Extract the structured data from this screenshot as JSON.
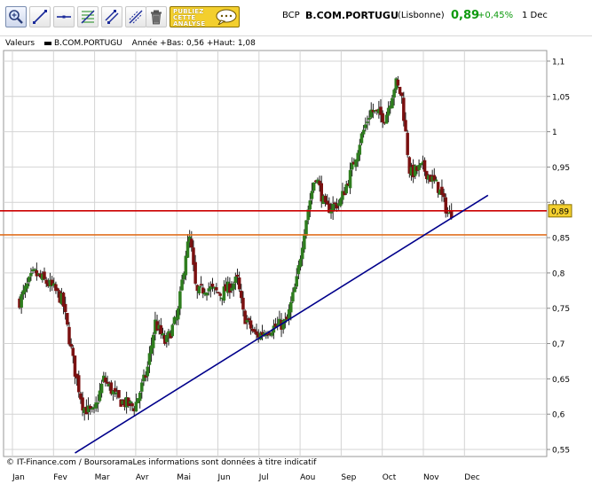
{
  "toolbar": {
    "tools": [
      {
        "name": "zoom-tool",
        "icon": "magnifier-icon"
      },
      {
        "name": "trend-line-tool",
        "icon": "diagonal-line-icon"
      },
      {
        "name": "horizontal-line-tool",
        "icon": "horizontal-line-icon"
      },
      {
        "name": "fibonacci-tool",
        "icon": "fibonacci-icon"
      },
      {
        "name": "channel-tool",
        "icon": "channel-icon"
      },
      {
        "name": "parallel-lines-tool",
        "icon": "parallel-lines-icon"
      },
      {
        "name": "delete-tool",
        "icon": "trash-icon"
      }
    ],
    "publish_button": {
      "lines": [
        "PUBLIEZ",
        "CETTE",
        "ANALYSE"
      ],
      "icon": "speech-bubble-icon"
    }
  },
  "header": {
    "ticker": "BCP",
    "name": "B.COM.PORTUGU",
    "market": "(Lisbonne)",
    "price": "0,89",
    "change": "+0,45%",
    "date": "1 Dec",
    "price_color": "#0e9a0e"
  },
  "legend": {
    "label": "Valeurs",
    "series": "B.COM.PORTUGU",
    "range": "Année +Bas: 0,56 +Haut: 1,08"
  },
  "footer": {
    "credit": "© IT-Finance.com / BoursoramaLes informations sont données à titre indicatif"
  },
  "chart_data": {
    "type": "candlestick",
    "x_labels": [
      "Jan",
      "Fev",
      "Mar",
      "Avr",
      "Mai",
      "Jun",
      "Jul",
      "Aou",
      "Sep",
      "Oct",
      "Nov",
      "Dec"
    ],
    "y_ticks": [
      "0,55",
      "0,6",
      "0,65",
      "0,7",
      "0,75",
      "0,8",
      "0,85",
      "0,9",
      "0,95",
      "1",
      "1,05",
      "1,1"
    ],
    "y_tick_values": [
      0.55,
      0.6,
      0.65,
      0.7,
      0.75,
      0.8,
      0.85,
      0.9,
      0.95,
      1.0,
      1.05,
      1.1
    ],
    "ylim": [
      0.54,
      1.115
    ],
    "grid": true,
    "up_color": "#2e7d1e",
    "down_color": "#7a1010",
    "anchors": [
      [
        0,
        0.76
      ],
      [
        0.35,
        0.8
      ],
      [
        0.8,
        0.78
      ],
      [
        1.05,
        0.76
      ],
      [
        1.35,
        0.66
      ],
      [
        1.55,
        0.61
      ],
      [
        1.8,
        0.6
      ],
      [
        2.05,
        0.65
      ],
      [
        2.4,
        0.62
      ],
      [
        2.8,
        0.61
      ],
      [
        3.1,
        0.66
      ],
      [
        3.3,
        0.73
      ],
      [
        3.55,
        0.7
      ],
      [
        3.85,
        0.74
      ],
      [
        4.05,
        0.83
      ],
      [
        4.15,
        0.85
      ],
      [
        4.3,
        0.77
      ],
      [
        4.55,
        0.78
      ],
      [
        4.9,
        0.77
      ],
      [
        5.3,
        0.79
      ],
      [
        5.45,
        0.74
      ],
      [
        5.75,
        0.71
      ],
      [
        6.05,
        0.72
      ],
      [
        6.5,
        0.73
      ],
      [
        6.75,
        0.79
      ],
      [
        6.95,
        0.87
      ],
      [
        7.2,
        0.94
      ],
      [
        7.45,
        0.89
      ],
      [
        7.8,
        0.9
      ],
      [
        8.05,
        0.94
      ],
      [
        8.3,
        0.99
      ],
      [
        8.55,
        1.03
      ],
      [
        8.9,
        1.02
      ],
      [
        9.15,
        1.07
      ],
      [
        9.3,
        1.05
      ],
      [
        9.5,
        0.94
      ],
      [
        9.8,
        0.95
      ],
      [
        10.2,
        0.92
      ],
      [
        10.45,
        0.88
      ],
      [
        10.55,
        0.89
      ]
    ],
    "resistance_line": {
      "value": 0.888,
      "color": "#cc0000",
      "label": "0,89"
    },
    "support_line": {
      "value": 0.854,
      "color": "#e07020"
    },
    "trend_line": {
      "start": [
        1.35,
        0.545
      ],
      "end": [
        11.4,
        0.91
      ],
      "color": "#00008b"
    }
  }
}
